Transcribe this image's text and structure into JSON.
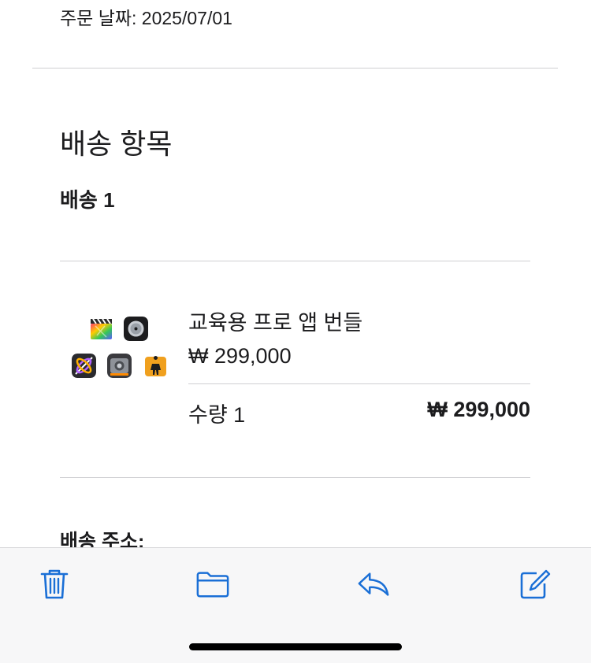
{
  "order": {
    "date_line": "주문 날짜: 2025/07/01"
  },
  "shipping": {
    "section_title": "배송 항목",
    "shipment_label": "배송 1",
    "item": {
      "name": "교육용 프로 앱 번들",
      "unit_price": "₩ 299,000",
      "quantity_text": "수량 1",
      "line_total": "₩ 299,000",
      "icons": [
        "final-cut-pro-icon",
        "logic-pro-icon",
        "motion-icon",
        "compressor-icon",
        "mainstage-icon"
      ]
    },
    "address_label": "배송 주소:"
  },
  "toolbar": {
    "buttons": [
      "trash-icon",
      "folder-icon",
      "reply-icon",
      "compose-icon"
    ],
    "accent_color": "#1a6fd6"
  }
}
